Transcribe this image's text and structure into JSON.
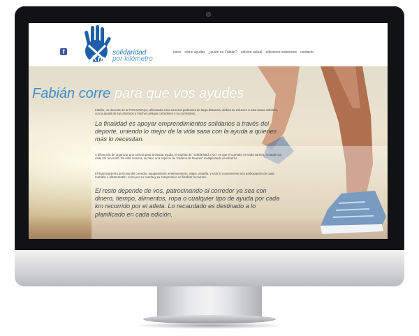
{
  "site": {
    "logo_line1": "solidaridad",
    "logo_line2": "por kilómetro",
    "logo_mark": "Km",
    "facebook_icon": "facebook-icon"
  },
  "nav": {
    "items": [
      {
        "label": "inicio"
      },
      {
        "label": "cómo ayudar"
      },
      {
        "label": "¿quién es Fabián?"
      },
      {
        "label": "edición actual"
      },
      {
        "label": "ediciones anteriores"
      },
      {
        "label": "contacto"
      }
    ]
  },
  "hero": {
    "title_part1": "Fabián corre",
    "title_part2": "para que vos ayudes"
  },
  "content": {
    "p1": "Fabián, un docente de la FCM-UNCuyo, aficionado a las carreras pedestres de larga distancia, dedica su esfuerzo a esta causa solidaria, con la ayuda de sus alumnos y muchos amigos corredores y no corredores.",
    "p2": "La finalidad es apoyar emprendimientos solidarios a través del deporte, uniendo lo mejor de la vida sana con la ayuda a quienes más lo necesitan.",
    "p3": "A diferencia de organizar una carrera para recaudar ayuda, el espíritu de \"Solidaridad x Km\" es que el corredor en cada carrera, recaude por cada km recorrido. De esta manera, se hace una especie de \"cadena de favores\" multiplicando el esfuerzo.",
    "p4": "El financiamiento personal del corredor, equipamiento, entrenamiento, viajes, estadía, y todo lo concerniente a la participación de cada maratón o ultramaratón, corre por su cuenta y su compromiso es finalizar la carrera.",
    "p5": "El resto depende de vos, patrocinando al corredor ya sea con dinero, tiempo, alimentos, ropa o cualquier tipo de ayuda por cada km recorrido por el atleta. Lo recaudado es destinado a lo planificado en cada edición."
  },
  "colors": {
    "accent": "#3d8fca",
    "logo_hand": "#1f5fa8",
    "bezel": "#111214"
  }
}
